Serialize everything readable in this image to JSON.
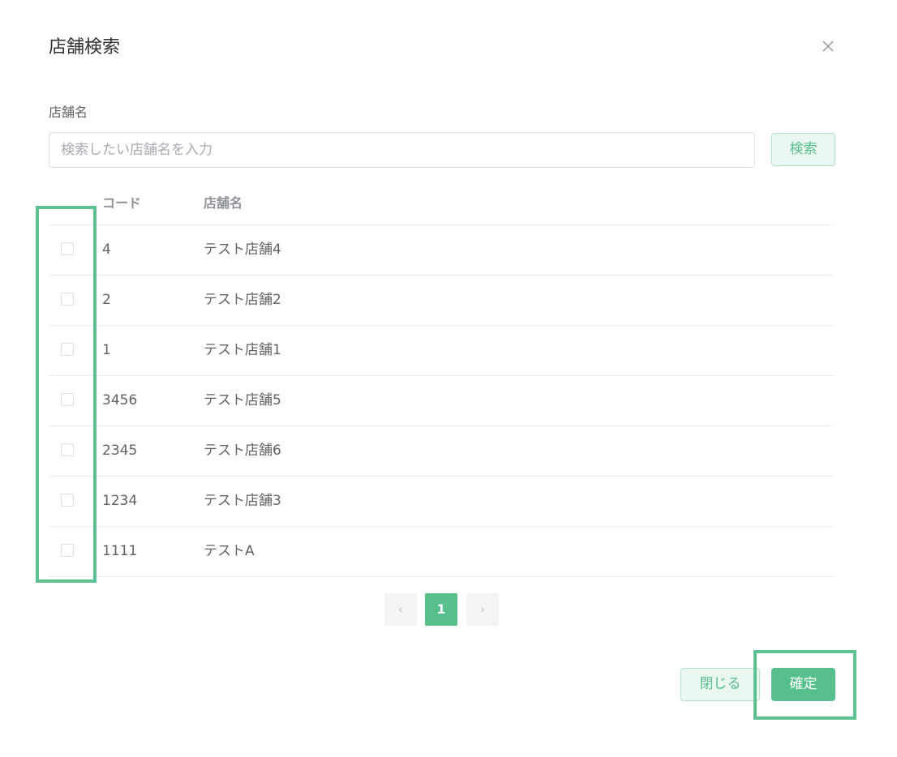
{
  "dialog": {
    "title": "店舗検索"
  },
  "search": {
    "label": "店舗名",
    "placeholder": "検索したい店舗名を入力",
    "value": "",
    "button_label": "検索"
  },
  "table": {
    "columns": [
      "コード",
      "店舗名"
    ],
    "rows": [
      {
        "code": "4",
        "name": "テスト店舗4",
        "checked": false
      },
      {
        "code": "2",
        "name": "テスト店舗2",
        "checked": false
      },
      {
        "code": "1",
        "name": "テスト店舗1",
        "checked": false
      },
      {
        "code": "3456",
        "name": "テスト店舗5",
        "checked": false
      },
      {
        "code": "2345",
        "name": "テスト店舗6",
        "checked": false
      },
      {
        "code": "1234",
        "name": "テスト店舗3",
        "checked": false
      },
      {
        "code": "1111",
        "name": "テストA",
        "checked": false
      }
    ]
  },
  "pagination": {
    "prev_icon": "‹",
    "current_page": "1",
    "next_icon": "›"
  },
  "footer": {
    "close_label": "閉じる",
    "confirm_label": "確定"
  },
  "colors": {
    "accent": "#56bf8c",
    "highlight": "#5ec192"
  }
}
